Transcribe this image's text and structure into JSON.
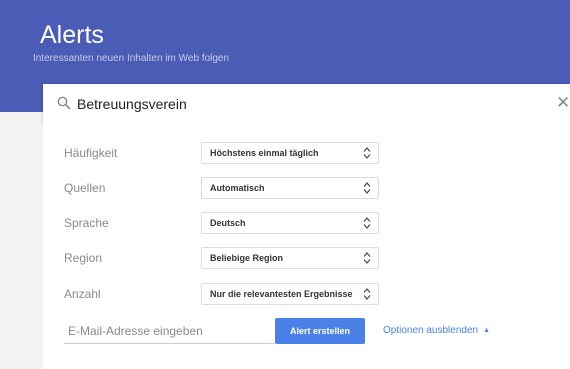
{
  "header": {
    "title": "Alerts",
    "subtitle": "Interessanten neuen Inhalten im Web folgen"
  },
  "search": {
    "query": "Betreuungsverein",
    "clear_symbol": "✕"
  },
  "options": [
    {
      "label": "Häufigkeit",
      "value": "Höchstens einmal täglich"
    },
    {
      "label": "Quellen",
      "value": "Automatisch"
    },
    {
      "label": "Sprache",
      "value": "Deutsch"
    },
    {
      "label": "Region",
      "value": "Beliebige Region"
    },
    {
      "label": "Anzahl",
      "value": "Nur die relevantesten Ergebnisse"
    }
  ],
  "footer": {
    "email_placeholder": "E-Mail-Adresse eingeben",
    "create_label": "Alert erstellen",
    "toggle_label": "Optionen ausblenden",
    "toggle_caret": "▲"
  },
  "colors": {
    "header_bg": "#4a5cb5",
    "accent": "#4a80e8"
  }
}
